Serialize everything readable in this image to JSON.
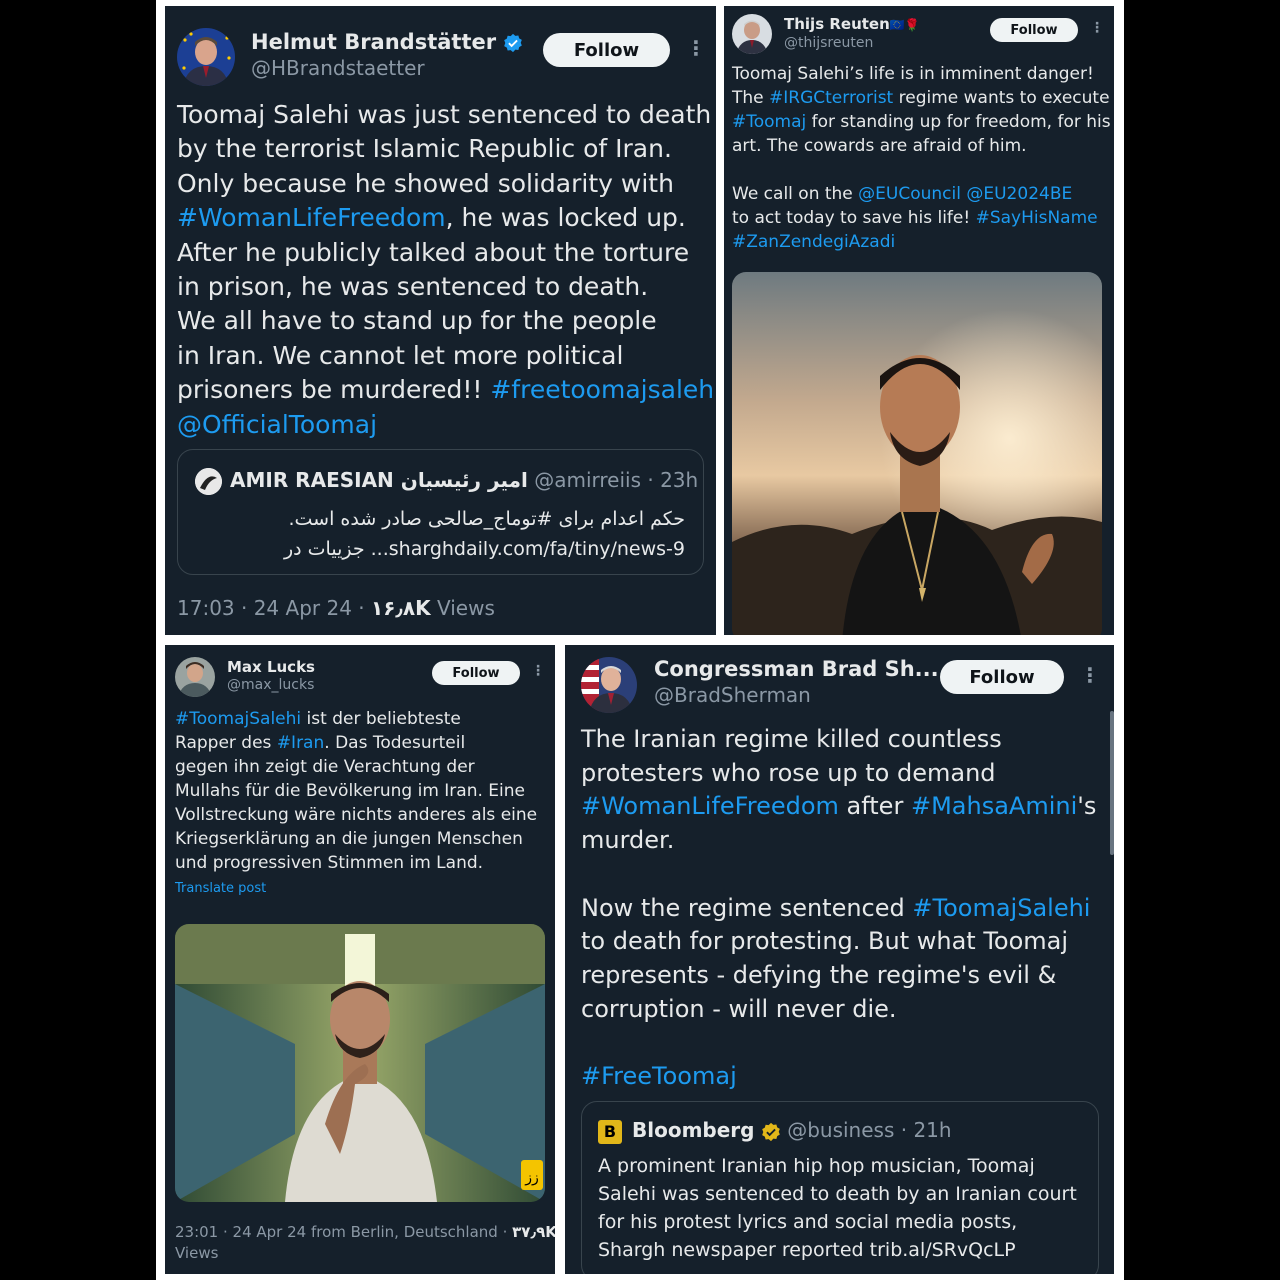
{
  "colors": {
    "background": "#15202b",
    "text": "#e7e9ea",
    "muted": "#8b98a5",
    "link": "#1d9bf0",
    "verified_blue": "#1d9bf0",
    "verified_gray": "#829aab",
    "verified_gold": "#e2b719"
  },
  "tweet1": {
    "name": "Helmut Brandstätter",
    "handle": "@HBrandstaetter",
    "follow_label": "Follow",
    "more": "⋮",
    "text_lines": [
      "Toomaj Salehi was just sentenced to death",
      "by the terrorist Islamic Republic of Iran.",
      "Only because he showed solidarity with",
      "#WomanLifeFreedom",
      ", he was locked up.",
      "After he publicly talked about the torture",
      "in prison, he was sentenced to death.",
      "We all have to stand up for the people",
      "in Iran. We cannot let more political",
      "prisoners be murdered!! ",
      "#freetoomajsalehi",
      "@OfficialToomaj"
    ],
    "quote": {
      "name": "AMIR RAESIAN امیر رئیسیان",
      "handle": "@amirreiis · 23h",
      "line1": "حکم اعدام برای #توماج_صالحی صادر شده است.",
      "line2": "جزییات در ...sharghdaily.com/fa/tiny/news-9"
    },
    "timestamp": "17:03 · 24 Apr 24 · ",
    "views_count": "۱۶٫۸K",
    "views_label": " Views"
  },
  "tweet2": {
    "name": "Thijs Reuten",
    "name_emoji": "🇪🇺🌹",
    "handle": "@thijsreuten",
    "follow_label": "Follow",
    "more": "⋮",
    "p1": [
      "Toomaj Salehi’s life is in imminent danger!",
      "The ",
      "#IRGCterrorist",
      " regime wants to execute",
      "#Toomaj",
      " for standing up for freedom, for his",
      "art. The cowards are afraid of him."
    ],
    "p2": [
      "We call on the ",
      "@EUCouncil",
      " ",
      "@EU2024BE",
      "to act today to save his life! ",
      "#SayHisName",
      "#ZanZendegiAzadi"
    ]
  },
  "tweet3": {
    "name": "Max Lucks",
    "handle": "@max_lucks",
    "follow_label": "Follow",
    "more": "⋮",
    "lines": [
      "#ToomajSalehi",
      " ist der beliebteste",
      "Rapper des ",
      "#Iran",
      ". Das Todesurteil",
      "gegen ihn zeigt die Verachtung der",
      "Mullahs für die Bevölkerung im Iran. Eine",
      "Vollstreckung wäre nichts anderes als eine",
      "Kriegserklärung an die jungen Menschen",
      "und progressiven Stimmen im Land."
    ],
    "translate": "Translate post",
    "watermark": "زز",
    "timestamp": "23:01 · 24 Apr 24 from Berlin, Deutschland · ",
    "views_count": "۳۷٫۹K",
    "views_label": "Views"
  },
  "tweet4": {
    "name": "Congressman Brad Sh...",
    "handle": "@BradSherman",
    "follow_label": "Follow",
    "more": "⋮",
    "p1": [
      "The Iranian regime killed countless",
      "protesters who rose up to demand",
      "#WomanLifeFreedom",
      " after ",
      "#MahsaAmini",
      "'s",
      "murder."
    ],
    "p2": [
      "Now the regime sentenced ",
      "#ToomajSalehi",
      "to death for protesting. But what Toomaj",
      "represents - defying the regime's evil &",
      "corruption - will never die."
    ],
    "p3": "#FreeToomaj",
    "quote": {
      "logo": "B",
      "name": "Bloomberg",
      "handle": "@business · 21h",
      "lines": [
        "A prominent Iranian hip hop musician, Toomaj",
        "Salehi was sentenced to death by an Iranian court",
        "for his protest lyrics and social media posts,",
        "Shargh newspaper reported trib.al/SRvQcLP"
      ]
    }
  }
}
